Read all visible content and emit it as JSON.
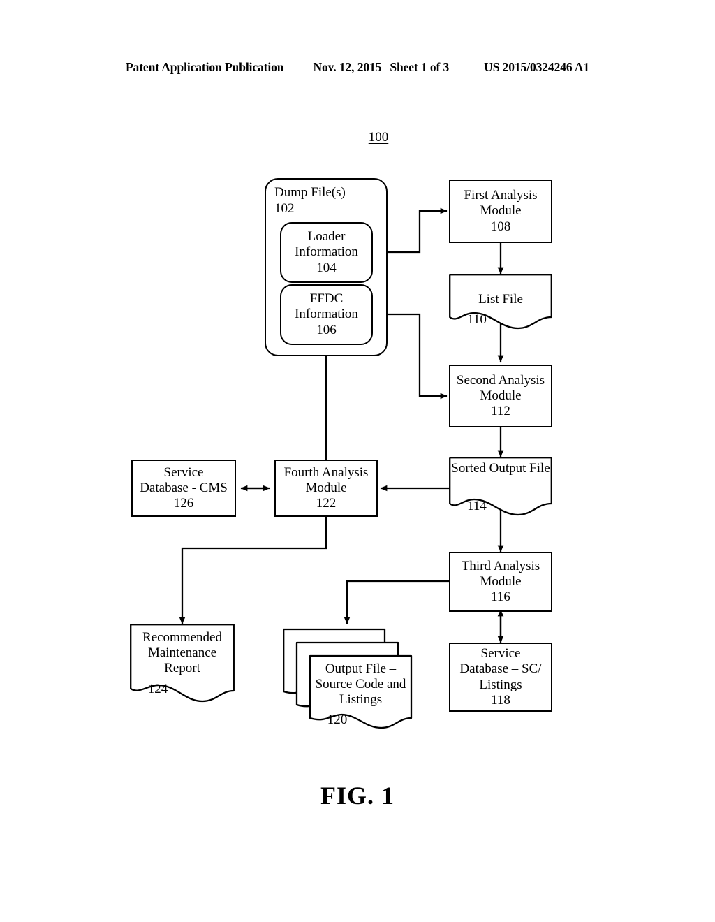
{
  "header": {
    "publication": "Patent Application Publication",
    "date": "Nov. 12, 2015",
    "sheet": "Sheet 1 of 3",
    "number": "US 2015/0324246 A1"
  },
  "figure": {
    "reference_numeral": "100",
    "caption": "FIG. 1"
  },
  "nodes": {
    "dump_files": {
      "title": "Dump File(s)",
      "num": "102"
    },
    "loader_information": {
      "line1": "Loader",
      "line2": "Information",
      "num": "104"
    },
    "ffdc_information": {
      "line1": "FFDC",
      "line2": "Information",
      "num": "106"
    },
    "first_analysis_module": {
      "line1": "First Analysis",
      "line2": "Module",
      "num": "108"
    },
    "list_file": {
      "line1": "List File",
      "num": "110"
    },
    "second_analysis_module": {
      "line1": "Second Analysis",
      "line2": "Module",
      "num": "112"
    },
    "sorted_output_file": {
      "line1": "Sorted",
      "line2": "Output",
      "line3": "File",
      "num": "114"
    },
    "third_analysis_module": {
      "line1": "Third Analysis",
      "line2": "Module",
      "num": "116"
    },
    "service_database_sc": {
      "line1": "Service",
      "line2": "Database – SC/",
      "line3": "Listings",
      "num": "118"
    },
    "output_file_source_code": {
      "line1": "Output File –",
      "line2": "Source Code and",
      "line3": "Listings",
      "num": "120"
    },
    "fourth_analysis_module": {
      "line1": "Fourth Analysis",
      "line2": "Module",
      "num": "122"
    },
    "recommended_maintenance_report": {
      "line1": "Recommended",
      "line2": "Maintenance",
      "line3": "Report",
      "num": "124"
    },
    "service_database_cms": {
      "line1": "Service",
      "line2": "Database - CMS",
      "num": "126"
    }
  },
  "colors": {
    "stroke": "#000000",
    "background": "#ffffff"
  }
}
